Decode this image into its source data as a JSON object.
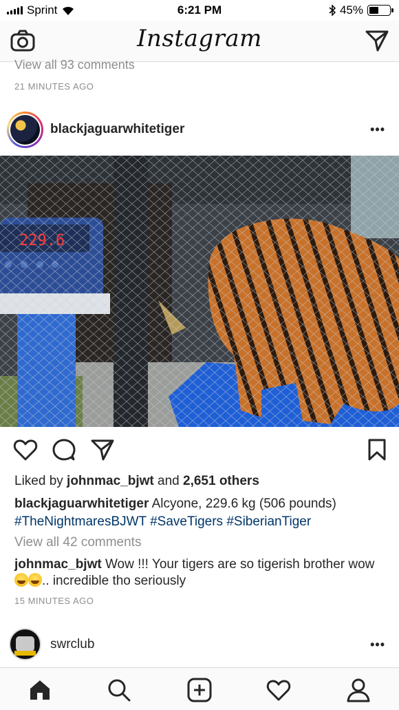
{
  "status_bar": {
    "carrier": "Sprint",
    "time": "6:21 PM",
    "battery": "45%",
    "battery_level": 0.45
  },
  "app": {
    "logo": "Instagram"
  },
  "previous_post": {
    "view_comments": "View all 93 comments",
    "time": "21 MINUTES AGO"
  },
  "post": {
    "username": "blackjaguarwhitetiger",
    "more": "•••",
    "scale_readout": "229.6",
    "likes_prefix": "Liked by ",
    "likes_user": "johnmac_bjwt",
    "likes_mid": " and ",
    "likes_count": "2,651 others",
    "caption_user": "blackjaguarwhitetiger",
    "caption_text": " Alcyone, 229.6 kg (506 pounds)",
    "caption_tags": "#TheNightmaresBJWT #SaveTigers #SiberianTiger",
    "view_comments": "View all 42 comments",
    "comment_user": "johnmac_bjwt",
    "comment_text_1": " Wow !!! Your tigers are so tigerish brother wow ",
    "comment_text_2": ".. incredible tho seriously",
    "time": "15 MINUTES AGO"
  },
  "next_post": {
    "username": "swrclub",
    "more": "•••"
  },
  "icons": {
    "status": [
      "signal-icon",
      "wifi-icon",
      "bluetooth-icon",
      "battery-icon"
    ],
    "nav": [
      "camera-icon",
      "direct-message-icon"
    ],
    "actions": [
      "heart-icon",
      "comment-icon",
      "share-icon",
      "bookmark-icon"
    ],
    "tabs": [
      "home-icon",
      "search-icon",
      "new-post-icon",
      "activity-icon",
      "profile-icon"
    ]
  },
  "colors": {
    "hashtag": "#003569",
    "muted": "#8e8e8e",
    "text": "#262626"
  }
}
